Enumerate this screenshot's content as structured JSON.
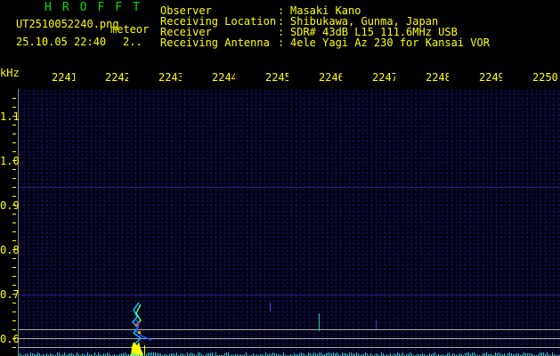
{
  "header": {
    "app_title": "HROFFT",
    "filename": "UT2510052240.png",
    "tag": "meteor",
    "datetime": "25.10.05 22:40",
    "count": "2..",
    "fields": [
      {
        "label": "Observer",
        "value": "Masaki Kano"
      },
      {
        "label": "Receiving Location",
        "value": "Shibukawa, Gunma, Japan"
      },
      {
        "label": "Receiver",
        "value": "SDR# 43dB L15 111.6MHz USB"
      },
      {
        "label": "Receiving Antenna",
        "value": "4ele Yagi Az 230 for Kansai VOR"
      }
    ]
  },
  "axes": {
    "y_unit": "kHz",
    "y_ticks": [
      "1.1",
      "1.0",
      "0.9",
      "0.8",
      "0.7",
      "0.6"
    ],
    "x_ticks": [
      "2241",
      "2242",
      "2243",
      "2244",
      "2245",
      "2246",
      "2247",
      "2248",
      "2249",
      "2250"
    ]
  },
  "colors": {
    "label": "#ffff00",
    "title": "#00e000",
    "meteor": "#ffff00"
  }
}
